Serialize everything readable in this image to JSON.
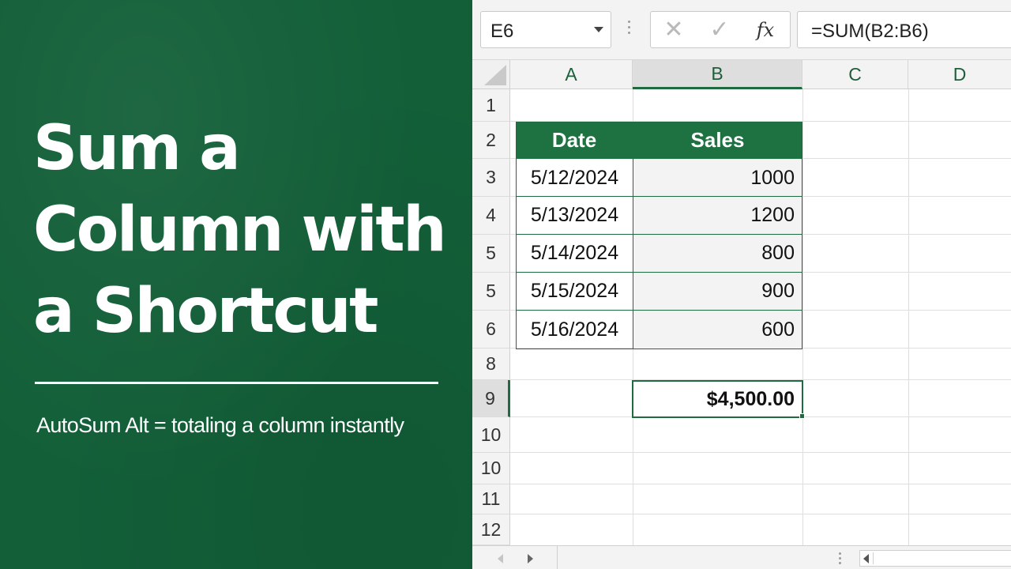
{
  "promo": {
    "title_lines": [
      "Sum a",
      "Column with",
      "a Shortcut"
    ],
    "subtitle": "AutoSum Alt = totaling a column instantly"
  },
  "formula_bar": {
    "name_box": "E6",
    "cancel_icon": "✕",
    "enter_icon": "✓",
    "fx_icon": "fx",
    "formula": "=SUM(B2:B6)"
  },
  "columns": [
    "A",
    "B",
    "C",
    "D"
  ],
  "rows": [
    "1",
    "2",
    "3",
    "4",
    "5",
    "5",
    "6",
    "8",
    "9",
    "10",
    "10",
    "11",
    "12"
  ],
  "table": {
    "headers": {
      "date": "Date",
      "sales": "Sales"
    },
    "rows": [
      {
        "date": "5/12/2024",
        "sales": "1000"
      },
      {
        "date": "5/13/2024",
        "sales": "1200"
      },
      {
        "date": "5/14/2024",
        "sales": "800"
      },
      {
        "date": "5/15/2024",
        "sales": "900"
      },
      {
        "date": "5/16/2024",
        "sales": "600"
      }
    ]
  },
  "total": "$4,500.00",
  "colors": {
    "brand_green": "#125f38",
    "header_green": "#1e7140",
    "accent_green": "#1d6b3f"
  },
  "icons": {
    "name_box_dropdown": "chevron-down-icon",
    "sheet_prev": "arrow-left-icon",
    "sheet_next": "arrow-right-icon",
    "scroll_left": "arrow-left-icon"
  }
}
